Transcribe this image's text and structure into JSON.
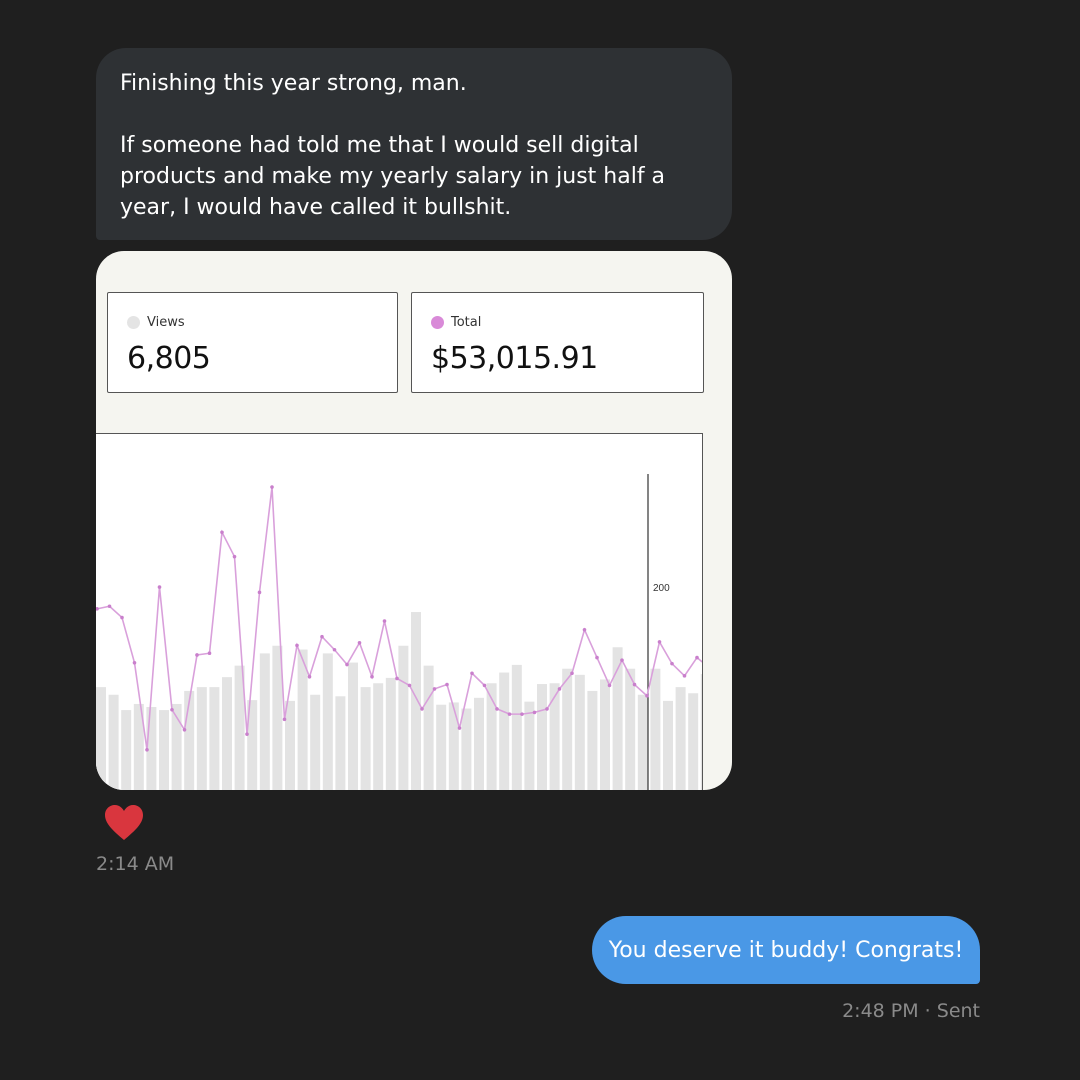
{
  "incoming_message": {
    "line1": "Finishing this year strong, man.",
    "line2": "If someone had told me that I would sell digital products and make my yearly salary in just half a year, I would have called it bullshit."
  },
  "image": {
    "views": {
      "label": "Views",
      "value": "6,805",
      "dot_color": "#e4e4e4"
    },
    "total": {
      "label": "Total",
      "value": "$53,015.91",
      "dot_color": "#d98ad8"
    },
    "chart_data": {
      "type": "bar",
      "y_tick_label": "200",
      "views_bars": [
        150,
        140,
        120,
        128,
        124,
        120,
        128,
        145,
        150,
        150,
        163,
        178,
        133,
        194,
        204,
        132,
        199,
        140,
        194,
        138,
        182,
        150,
        155,
        162,
        204,
        248,
        178,
        127,
        130,
        122,
        136,
        155,
        169,
        179,
        131,
        154,
        155,
        174,
        166,
        145,
        160,
        202,
        174,
        140,
        174,
        132,
        150,
        142,
        167
      ],
      "sales_bars": [
        0,
        0,
        3,
        3,
        0,
        2,
        0,
        0,
        2,
        0,
        3,
        0,
        2,
        0,
        0,
        3,
        4,
        3,
        4,
        2,
        4,
        3,
        0,
        2,
        0,
        2,
        0,
        0,
        0,
        0,
        0,
        0,
        2,
        0,
        0,
        0,
        0,
        0,
        0,
        3,
        0,
        4,
        0,
        0,
        0,
        0,
        0,
        0,
        0
      ],
      "total_line": [
        222,
        225,
        212,
        160,
        60,
        247,
        106,
        83,
        169,
        171,
        310,
        282,
        78,
        241,
        362,
        95,
        180,
        144,
        190,
        175,
        158,
        183,
        144,
        208,
        142,
        134,
        107,
        130,
        135,
        85,
        148,
        134,
        107,
        101,
        101,
        103,
        107,
        130,
        148,
        198,
        166,
        134,
        163,
        135,
        122,
        184,
        159,
        145,
        166,
        154
      ]
    }
  },
  "reaction": {
    "icon": "heart-icon",
    "color": "#d9363e"
  },
  "incoming_time": "2:14 AM",
  "outgoing_message": {
    "text": "You deserve it buddy! Congrats!"
  },
  "outgoing_status": "2:48 PM · Sent"
}
